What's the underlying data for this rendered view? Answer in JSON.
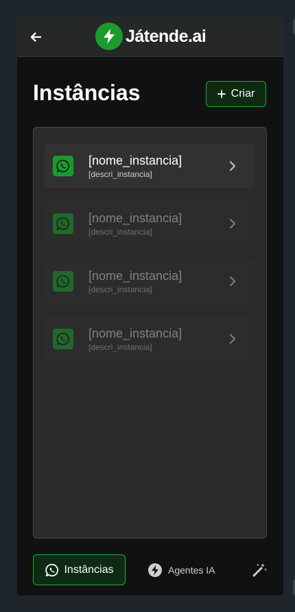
{
  "header": {
    "brand_name": "Játende.ai"
  },
  "page": {
    "title": "Instâncias",
    "create_label": "Criar"
  },
  "instances": [
    {
      "name": "[nome_instancia]",
      "description": "[descri_instancia]",
      "state": "active"
    },
    {
      "name": "[nome_instancia]",
      "description": "[descri_instancia]",
      "state": "dimmed"
    },
    {
      "name": "[nome_instancia]",
      "description": "[descri_instancia]",
      "state": "dimmed"
    },
    {
      "name": "[nome_instancia]",
      "description": "[descri_instancia]",
      "state": "dimmed"
    }
  ],
  "bottom_nav": {
    "instances_label": "Instâncias",
    "agents_label": "Agentes IA"
  },
  "icons": {
    "back": "arrow-left-icon",
    "brand": "lightning-bolt-icon",
    "create": "plus-icon",
    "instance": "whatsapp-icon",
    "row": "chevron-right-icon",
    "agents": "lightning-bolt-icon",
    "magic": "magic-wand-icon"
  },
  "colors": {
    "accent": "#25a93a",
    "brand_green": "#1b9b2e",
    "background": "#101212",
    "panel": "#2a2a2a"
  }
}
